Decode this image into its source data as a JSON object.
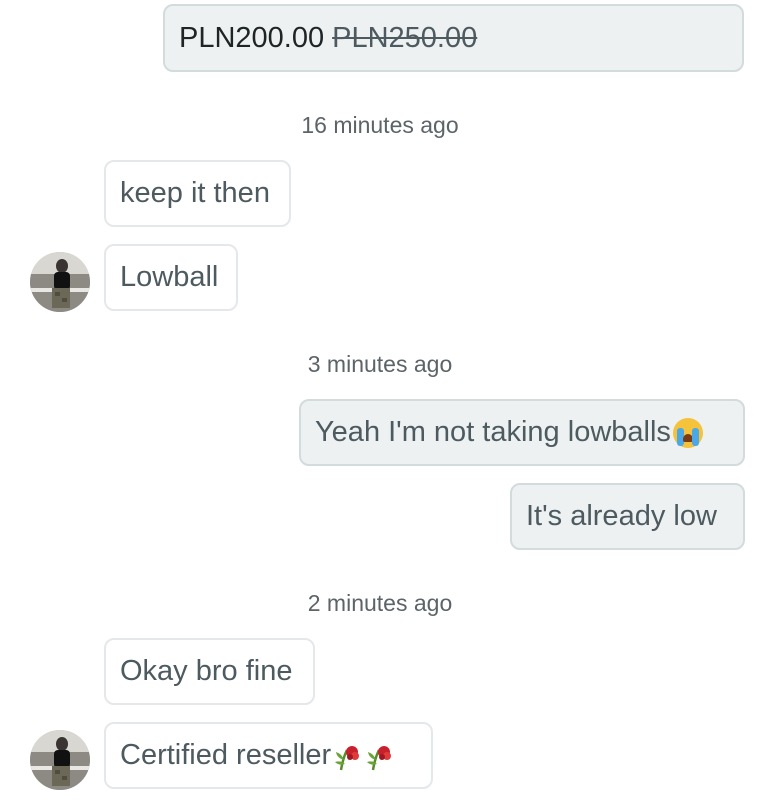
{
  "offer": {
    "price": "PLN200.00",
    "old_price": "PLN250.00"
  },
  "timestamps": [
    "16 minutes ago",
    "3 minutes ago",
    "2 minutes ago"
  ],
  "messages": [
    {
      "text": "keep it then",
      "from": "other"
    },
    {
      "text": "Lowball",
      "from": "other"
    },
    {
      "text": "Yeah I'm not taking lowballs",
      "from": "me",
      "emoji": "crying-face-icon"
    },
    {
      "text": "It's already low",
      "from": "me"
    },
    {
      "text": "Okay bro fine",
      "from": "other"
    },
    {
      "text": "Certified reseller",
      "from": "other",
      "emoji": "wilted-flower-icon"
    }
  ],
  "colors": {
    "outgoing_bg": "#edf1f1",
    "incoming_border": "#e5e8ea",
    "text": "#4d5a60"
  }
}
